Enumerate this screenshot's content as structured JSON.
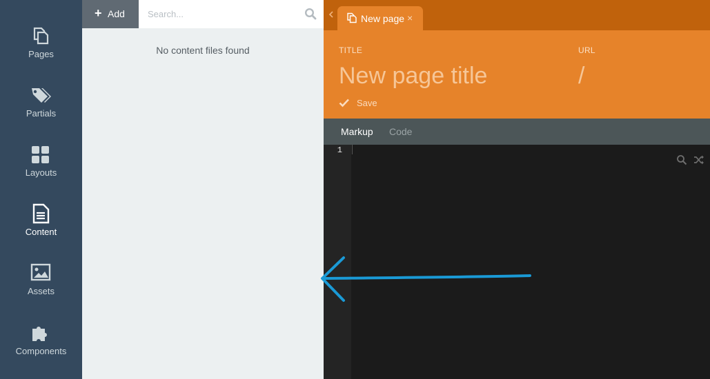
{
  "sidebar": {
    "items": [
      {
        "label": "Pages",
        "icon": "pages-icon",
        "active": false
      },
      {
        "label": "Partials",
        "icon": "tags-icon",
        "active": false
      },
      {
        "label": "Layouts",
        "icon": "grid-icon",
        "active": false
      },
      {
        "label": "Content",
        "icon": "file-text-icon",
        "active": true
      },
      {
        "label": "Assets",
        "icon": "image-icon",
        "active": false
      },
      {
        "label": "Components",
        "icon": "puzzle-icon",
        "active": false
      }
    ]
  },
  "list": {
    "add_label": "Add",
    "search_placeholder": "Search...",
    "empty_message": "No content files found"
  },
  "editor": {
    "tab": {
      "title": "New page",
      "close": "×"
    },
    "title_label": "TITLE",
    "title_placeholder": "New page title",
    "url_label": "URL",
    "url_placeholder": "/",
    "save_label": "Save",
    "subtabs": [
      {
        "label": "Markup",
        "active": true
      },
      {
        "label": "Code",
        "active": false
      }
    ],
    "line_numbers": [
      "1"
    ]
  },
  "colors": {
    "sidebar_bg": "#34495e",
    "accent": "#e6832a",
    "accent_dark": "#c0620c",
    "annotation": "#1a9ad6"
  }
}
